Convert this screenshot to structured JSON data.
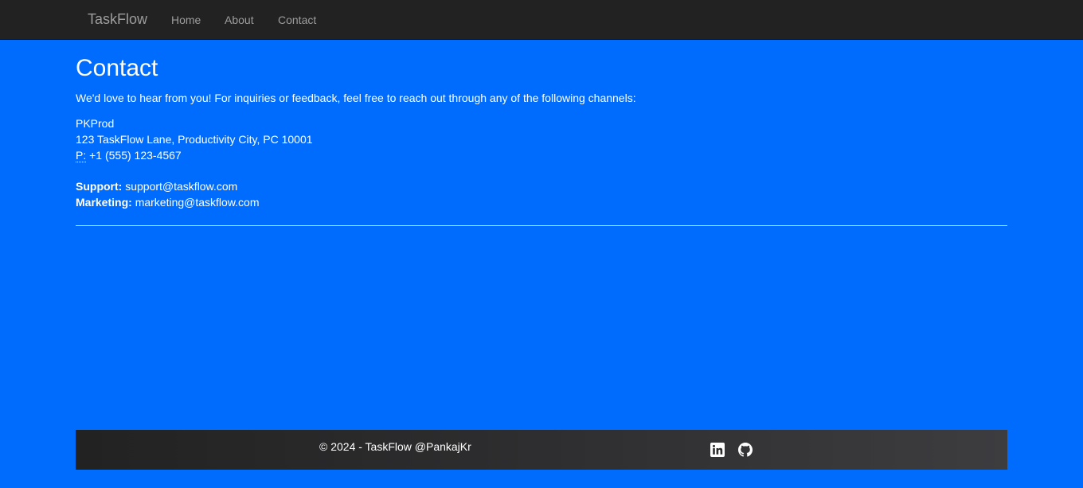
{
  "navbar": {
    "brand": "TaskFlow",
    "links": [
      "Home",
      "About",
      "Contact"
    ]
  },
  "page": {
    "title": "Contact",
    "intro": "We'd love to hear from you! For inquiries or feedback, feel free to reach out through any of the following channels:"
  },
  "address": {
    "name": "PKProd",
    "street": "123 TaskFlow Lane, Productivity City, PC 10001",
    "phone_label": "P:",
    "phone": "+1 (555) 123-4567"
  },
  "emails": {
    "support_label": "Support:",
    "support": "support@taskflow.com",
    "marketing_label": "Marketing:",
    "marketing": "marketing@taskflow.com"
  },
  "footer": {
    "copyright": "© 2024 - TaskFlow @PankajKr",
    "icons": [
      "linkedin-icon",
      "github-icon"
    ]
  },
  "colors": {
    "page_background": "#006cfe",
    "navbar_background": "#222222",
    "nav_text": "#9d9d9d",
    "text": "#ffffff"
  }
}
